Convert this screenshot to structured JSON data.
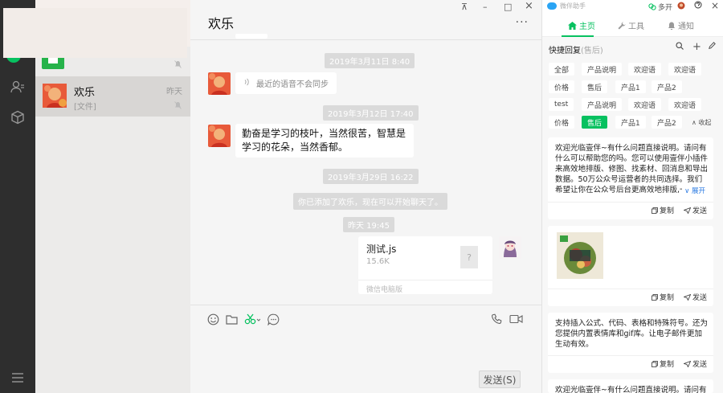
{
  "conversation_list": {
    "item": {
      "name": "欢乐",
      "subtitle": "[文件]",
      "time": "昨天"
    }
  },
  "chat": {
    "title": "欢乐",
    "window_controls": {
      "pin": "⊼",
      "minimize": "–",
      "maximize": "□",
      "close": "×"
    },
    "more": "···",
    "messages": [
      {
        "timestamp": "2019年3月11日 8:40"
      },
      {
        "voice_text": "最近的语音不会同步"
      },
      {
        "timestamp": "2019年3月12日 17:40"
      },
      {
        "text": "勤奋是学习的枝叶，当然很苦，智慧是学习的花朵，当然香郁。"
      },
      {
        "timestamp": "2019年3月29日 16:22"
      },
      {
        "system": "你已添加了欢乐，现在可以开始聊天了。"
      },
      {
        "timestamp": "昨天 19:45"
      }
    ],
    "file": {
      "name": "测试.js",
      "size": "15.6K",
      "source": "微信电脑版",
      "icon": "?"
    },
    "send_label": "发送(S)"
  },
  "assistant": {
    "brand": "微伴助手",
    "multi_open": "多开",
    "tabs": {
      "home": "主页",
      "tools": "工具",
      "notify": "通知"
    },
    "quick_reply_title": "快捷回复",
    "quick_reply_sub": "(售后)",
    "chips_row1": [
      "全部",
      "产品说明",
      "欢迎语",
      "欢迎语"
    ],
    "chips_row2": [
      "价格",
      "售后",
      "产品1",
      "产品2"
    ],
    "chips_row3": [
      "test",
      "产品说明",
      "欢迎语",
      "欢迎语"
    ],
    "chips_row4": [
      "价格",
      "售后",
      "产品1",
      "产品2"
    ],
    "collapse_label": "∧ 收起",
    "card1_text": "欢迎光临壹伴~有什么问题直接说明。请问有什么可以帮助您的吗。您可以使用壹伴小插件来高效地排版、修图、找素材、回消息和导出数据。50万公众号运营者的共同选择。我们希望让你在公众号后台更高效地排版,一...",
    "card1_expand": "∨ 展开",
    "card3_text": "支持插入公式、代码、表格和特殊符号。还为您提供内置表情库和gif库。让电子邮件更加生动有效。",
    "card4_text": "欢迎光临壹伴~有什么问题直接说明。请问有什",
    "copy": "复制",
    "send": "发送"
  },
  "colors": {
    "accent": "#07c160",
    "nav_bg": "#2e2e2e",
    "link": "#2a7ae2"
  }
}
